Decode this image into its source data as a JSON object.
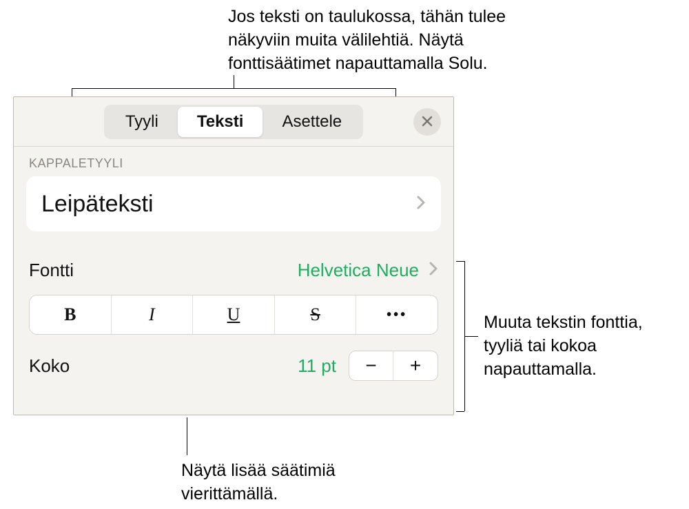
{
  "callouts": {
    "top": "Jos teksti on taulukossa, tähän tulee näkyviin muita välilehtiä. Näytä fonttisäätimet napauttamalla Solu.",
    "right": "Muuta tekstin fonttia, tyyliä tai kokoa napauttamalla.",
    "bottom": "Näytä lisää säätimiä vierittämällä."
  },
  "tabs": {
    "style": "Tyyli",
    "text": "Teksti",
    "arrange": "Asettele"
  },
  "section_label": "KAPPALETYYLI",
  "paragraph_style": "Leipäteksti",
  "font": {
    "label": "Fontti",
    "value": "Helvetica Neue"
  },
  "style_buttons": {
    "bold": "B",
    "italic": "I",
    "underline": "U",
    "strike": "S",
    "more": "•••"
  },
  "size": {
    "label": "Koko",
    "value": "11 pt",
    "minus": "−",
    "plus": "+"
  }
}
